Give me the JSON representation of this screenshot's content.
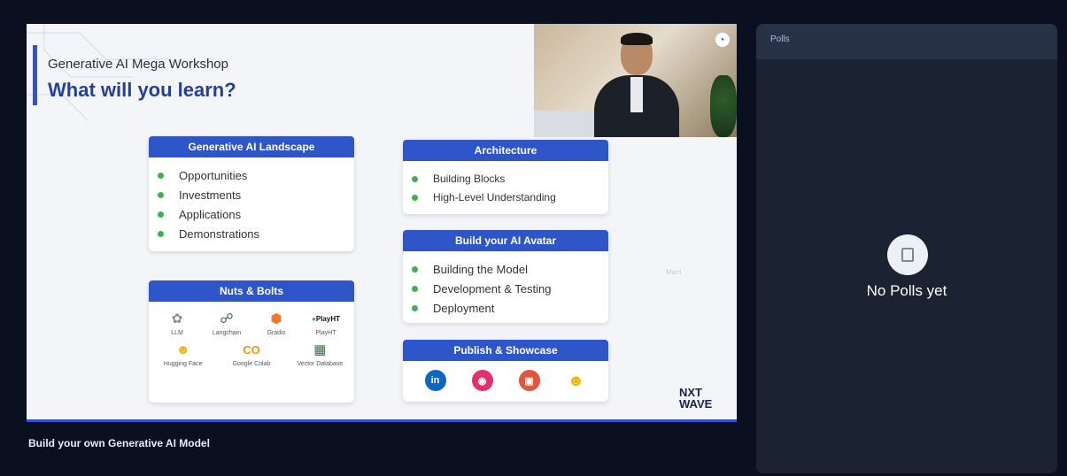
{
  "slide": {
    "subtitle": "Generative AI Mega Workshop",
    "title": "What will you learn?",
    "watermark": "Mani",
    "brand_line1": "NXT",
    "brand_line2": "WAVE",
    "cards": {
      "landscape": {
        "heading": "Generative AI Landscape",
        "items": [
          "Opportunities",
          "Investments",
          "Applications",
          "Demonstrations"
        ]
      },
      "architecture": {
        "heading": "Architecture",
        "items": [
          "Building Blocks",
          "High-Level Understanding"
        ]
      },
      "avatar": {
        "heading": "Build your AI Avatar",
        "items": [
          "Building the Model",
          "Development & Testing",
          "Deployment"
        ]
      },
      "nuts": {
        "heading": "Nuts & Bolts",
        "tools": [
          {
            "label": "LLM",
            "icon": "brain-icon"
          },
          {
            "label": "Langchain",
            "icon": "langchain-icon"
          },
          {
            "label": "Gradio",
            "icon": "gradio-icon"
          },
          {
            "label": "PlayHT",
            "icon": "playht-icon",
            "logo_text": "PlayHT"
          },
          {
            "label": "Hugging Face",
            "icon": "huggingface-icon"
          },
          {
            "label": "Google Colab",
            "icon": "colab-icon",
            "logo_text": "CO"
          },
          {
            "label": "Vector Database",
            "icon": "database-icon"
          }
        ]
      },
      "publish": {
        "heading": "Publish & Showcase",
        "socials": [
          {
            "icon": "linkedin-icon",
            "text": "in",
            "color": "#1166c2"
          },
          {
            "icon": "instagram-icon",
            "color": "#e1306c"
          },
          {
            "icon": "notebook-icon",
            "color": "#e2553f"
          },
          {
            "icon": "huggingface-icon",
            "color": "#f7c948"
          }
        ]
      }
    }
  },
  "caption": "Build your own Generative AI Model",
  "polls": {
    "title": "Polls",
    "empty_text": "No Polls yet"
  },
  "colors": {
    "accent": "#2e56c9",
    "bullet": "#3bb34f",
    "panel": "#1b2333",
    "background": "#0b1020"
  }
}
